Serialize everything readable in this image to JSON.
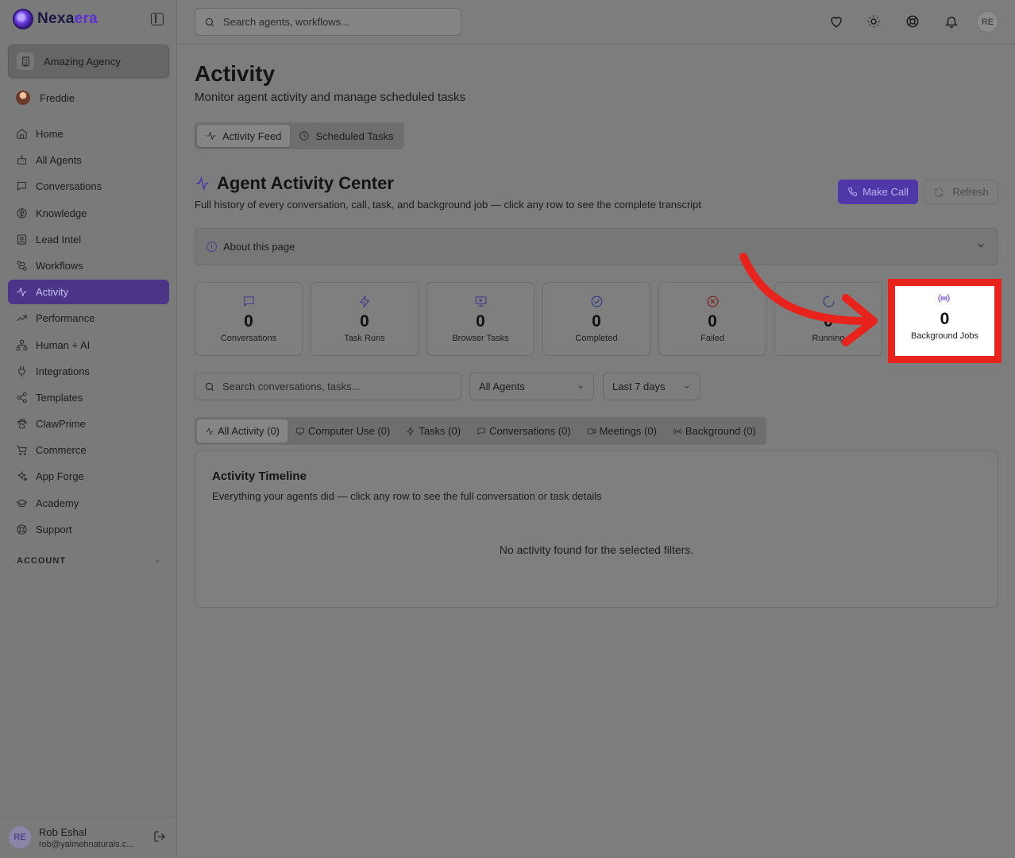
{
  "app": {
    "logo_main": "Nexa",
    "logo_accent": "era"
  },
  "sidebar": {
    "org_name": "Amazing Agency",
    "user_name": "Freddie",
    "items": [
      {
        "label": "Home",
        "icon": "home-icon"
      },
      {
        "label": "All Agents",
        "icon": "bot-icon"
      },
      {
        "label": "Conversations",
        "icon": "message-icon"
      },
      {
        "label": "Knowledge",
        "icon": "brain-icon"
      },
      {
        "label": "Lead Intel",
        "icon": "contact-icon"
      },
      {
        "label": "Workflows",
        "icon": "workflow-icon"
      },
      {
        "label": "Activity",
        "icon": "activity-icon",
        "active": true
      },
      {
        "label": "Performance",
        "icon": "trending-icon"
      },
      {
        "label": "Human + AI",
        "icon": "network-icon"
      },
      {
        "label": "Integrations",
        "icon": "plug-icon"
      },
      {
        "label": "Templates",
        "icon": "share-icon"
      },
      {
        "label": "ClawPrime",
        "icon": "paw-icon"
      },
      {
        "label": "Commerce",
        "icon": "cart-icon"
      },
      {
        "label": "App Forge",
        "icon": "sparkles-icon"
      },
      {
        "label": "Academy",
        "icon": "graduation-cap-icon"
      },
      {
        "label": "Support",
        "icon": "lifebuoy-icon"
      }
    ],
    "account_label": "ACCOUNT",
    "footer": {
      "initials": "RE",
      "name": "Rob Eshal",
      "email": "rob@yalmehnaturals.c..."
    }
  },
  "topbar": {
    "search_placeholder": "Search agents, workflows...",
    "avatar_initials": "RE"
  },
  "page": {
    "title": "Activity",
    "subtitle": "Monitor agent activity and manage scheduled tasks",
    "tabs": [
      {
        "label": "Activity Feed",
        "active": true
      },
      {
        "label": "Scheduled Tasks",
        "active": false
      }
    ],
    "section_title": "Agent Activity Center",
    "section_subtitle": "Full history of every conversation, call, task, and background job — click any row to see the complete transcript",
    "make_call_label": "Make Call",
    "refresh_label": "Refresh",
    "about_label": "About this page",
    "stats": [
      {
        "value": "0",
        "label": "Conversations",
        "icon": "message-icon",
        "color": "#4a3f86"
      },
      {
        "value": "0",
        "label": "Task Runs",
        "icon": "zap-icon",
        "color": "#4a3f86"
      },
      {
        "value": "0",
        "label": "Browser Tasks",
        "icon": "monitor-icon",
        "color": "#4a3f86"
      },
      {
        "value": "0",
        "label": "Completed",
        "icon": "check-circle-icon",
        "color": "#2f3f80"
      },
      {
        "value": "0",
        "label": "Failed",
        "icon": "x-circle-icon",
        "color": "#7a1f1f"
      },
      {
        "value": "0",
        "label": "Running",
        "icon": "loader-icon",
        "color": "#2f3f80"
      },
      {
        "value": "0",
        "label": "Background Jobs",
        "icon": "radio-icon",
        "color": "#7c55e6"
      }
    ],
    "filters": {
      "search_placeholder": "Search conversations, tasks...",
      "agent_select": "All Agents",
      "range_select": "Last 7 days"
    },
    "activity_tabs": [
      {
        "label": "All Activity (0)",
        "icon": "activity-icon",
        "active": true
      },
      {
        "label": "Computer Use (0)",
        "icon": "monitor-icon"
      },
      {
        "label": "Tasks (0)",
        "icon": "zap-icon"
      },
      {
        "label": "Conversations (0)",
        "icon": "message-icon"
      },
      {
        "label": "Meetings (0)",
        "icon": "video-icon"
      },
      {
        "label": "Background (0)",
        "icon": "radio-icon"
      }
    ],
    "timeline": {
      "title": "Activity Timeline",
      "subtitle": "Everything your agents did — click any row to see the full conversation or task details",
      "empty": "No activity found for the selected filters."
    }
  },
  "annotation": {
    "highlight_color": "#e8231c"
  }
}
